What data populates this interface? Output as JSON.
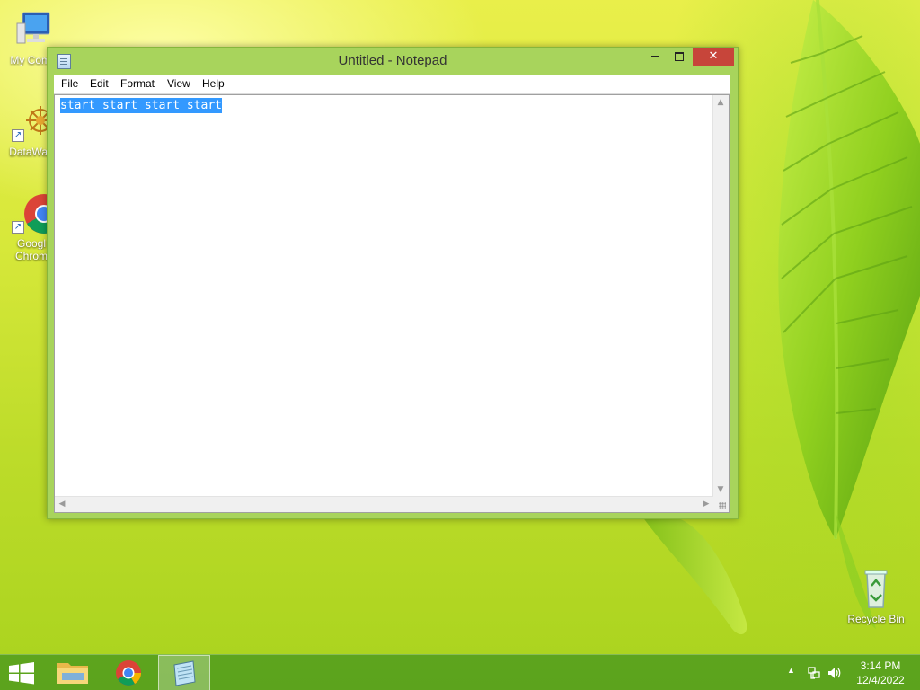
{
  "desktop": {
    "icons": [
      {
        "label": "My Comp"
      },
      {
        "label": "DataWag"
      },
      {
        "label": "Googl",
        "label2": "Chrom"
      },
      {
        "label": "Recycle Bin"
      }
    ]
  },
  "window": {
    "title": "Untitled - Notepad",
    "close_glyph": "✕",
    "menu": [
      "File",
      "Edit",
      "Format",
      "View",
      "Help"
    ],
    "content": "start start start start",
    "content_selected": true
  },
  "taskbar": {
    "apps": [
      "windows-start",
      "file-explorer",
      "google-chrome",
      "notepad"
    ],
    "active_app": "notepad"
  },
  "tray": {
    "time": "3:14 PM",
    "date": "12/4/2022",
    "icons": [
      "show-hidden-icons",
      "network-icon",
      "volume-icon"
    ]
  },
  "colors": {
    "titlebar": "#a8d45c",
    "close_button": "#c7453a",
    "selection": "#3399ff",
    "taskbar": "#4a961e"
  }
}
